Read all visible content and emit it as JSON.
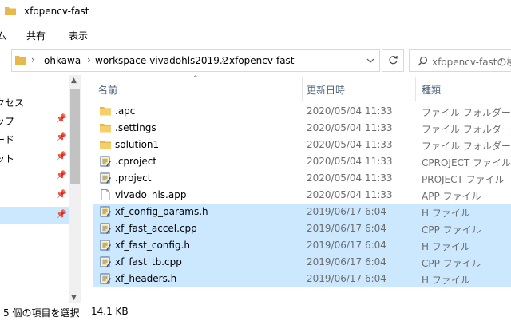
{
  "window": {
    "title": "xfopencv-fast"
  },
  "ribbon": {
    "tabs": [
      {
        "label": "ム"
      },
      {
        "label": "共有"
      },
      {
        "label": "表示"
      }
    ]
  },
  "address": {
    "breadcrumbs": [
      "ohkawa",
      "workspace-vivadohls2019.2",
      "xfopencv-fast"
    ],
    "separator": "›"
  },
  "search": {
    "placeholder": "xfopencv-fastの検索"
  },
  "nav": {
    "items": [
      {
        "label": "クセス",
        "pinned": false
      },
      {
        "label": "ップ",
        "pinned": true
      },
      {
        "label": "ード",
        "pinned": true
      },
      {
        "label": "ット",
        "pinned": true
      },
      {
        "label": "",
        "pinned": true
      },
      {
        "label": "",
        "pinned": true
      },
      {
        "label": "",
        "pinned": true,
        "selected": true
      }
    ]
  },
  "columns": {
    "name": "名前",
    "date": "更新日時",
    "type": "種類"
  },
  "files": [
    {
      "name": ".apc",
      "date": "2020/05/04 11:33",
      "type": "ファイル フォルダー",
      "icon": "folder",
      "selected": false
    },
    {
      "name": ".settings",
      "date": "2020/05/04 11:33",
      "type": "ファイル フォルダー",
      "icon": "folder",
      "selected": false
    },
    {
      "name": "solution1",
      "date": "2020/05/04 11:33",
      "type": "ファイル フォルダー",
      "icon": "folder",
      "selected": false
    },
    {
      "name": ".cproject",
      "date": "2020/05/04 11:33",
      "type": "CPROJECT ファイル",
      "icon": "code",
      "selected": false
    },
    {
      "name": ".project",
      "date": "2020/05/04 11:33",
      "type": "PROJECT ファイル",
      "icon": "code",
      "selected": false
    },
    {
      "name": "vivado_hls.app",
      "date": "2020/05/04 11:33",
      "type": "APP ファイル",
      "icon": "blank",
      "selected": false
    },
    {
      "name": "xf_config_params.h",
      "date": "2019/06/17 6:04",
      "type": "H ファイル",
      "icon": "code",
      "selected": true
    },
    {
      "name": "xf_fast_accel.cpp",
      "date": "2019/06/17 6:04",
      "type": "CPP ファイル",
      "icon": "code",
      "selected": true
    },
    {
      "name": "xf_fast_config.h",
      "date": "2019/06/17 6:04",
      "type": "H ファイル",
      "icon": "code",
      "selected": true
    },
    {
      "name": "xf_fast_tb.cpp",
      "date": "2019/06/17 6:04",
      "type": "CPP ファイル",
      "icon": "code",
      "selected": true
    },
    {
      "name": "xf_headers.h",
      "date": "2019/06/17 6:04",
      "type": "H ファイル",
      "icon": "code",
      "selected": true
    }
  ],
  "status": {
    "selection": "5 個の項目を選択",
    "size": "14.1 KB"
  },
  "colors": {
    "selection": "#cce8ff",
    "folder": "#e8b84a",
    "header_text": "#4c607a"
  }
}
